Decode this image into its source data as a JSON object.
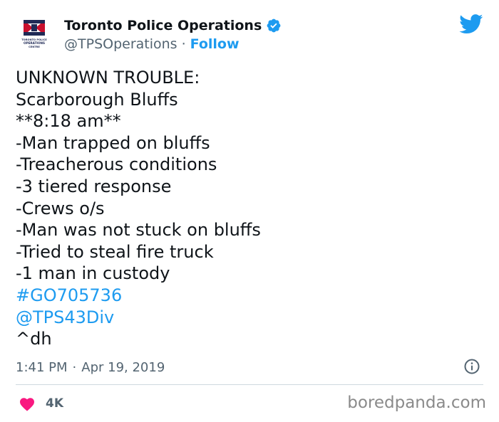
{
  "header": {
    "display_name": "Toronto Police Operations",
    "handle": "@TPSOperations",
    "separator": "·",
    "follow_label": "Follow",
    "avatar_text": [
      "TORONTO POLICE",
      "OPERATIONS",
      "CENTRE"
    ]
  },
  "tweet": {
    "lines": [
      "UNKNOWN TROUBLE:",
      "Scarborough Bluffs",
      "**8:18 am**",
      "-Man trapped on bluffs",
      "-Treacherous conditions",
      "-3 tiered response",
      "-Crews o/s",
      "-Man was not stuck on bluffs",
      "-Tried to steal fire truck",
      "-1 man in custody"
    ],
    "hashtag": "#GO705736",
    "mention": "@TPS43Div",
    "signature": "^dh"
  },
  "meta": {
    "time": "1:41 PM",
    "separator": "·",
    "date": "Apr 19, 2019"
  },
  "footer": {
    "like_count": "4K",
    "watermark": "boredpanda.com"
  },
  "colors": {
    "accent": "#1d9bf0",
    "text": "#0f1419",
    "muted": "#536471",
    "heart": "#f91880"
  },
  "icons": [
    "verified-badge-icon",
    "twitter-bird-icon",
    "info-icon",
    "heart-icon"
  ]
}
